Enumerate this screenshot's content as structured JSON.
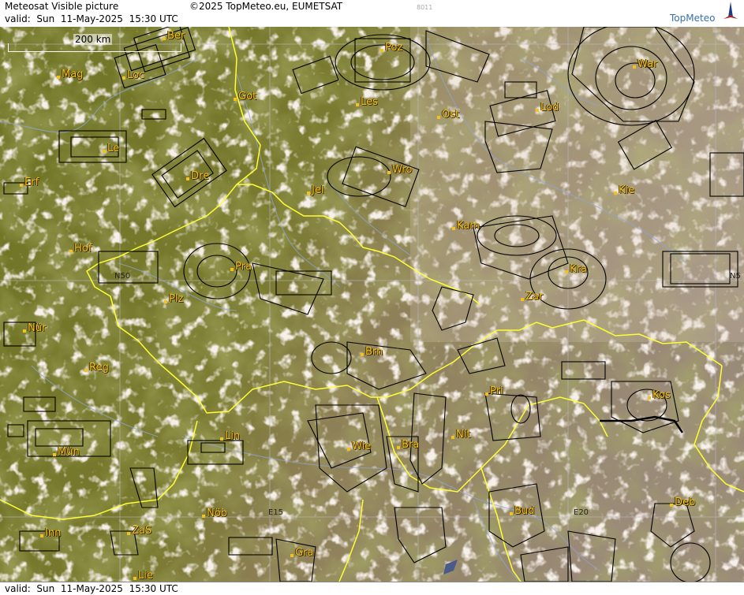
{
  "header": {
    "title": "Meteosat Visible picture",
    "copyright": "©2025 TopMeteo.eu, EUMETSAT",
    "frame_id": "8011",
    "valid": "valid:  Sun  11-May-2025  15:30 UTC",
    "logo": "TopMeteo"
  },
  "footer": {
    "valid": "valid:  Sun  11-May-2025  15:30 UTC"
  },
  "scale_bar": {
    "label": "200 km"
  },
  "grid_labels": [
    "N50",
    "N5",
    "E15",
    "E20"
  ],
  "cities": [
    "Ber",
    "Poz",
    "War",
    "Mag",
    "Loc",
    "Got",
    "Les",
    "Lod",
    "Ost",
    "Le",
    "Dre",
    "Wro",
    "Erf",
    "Jel",
    "Kie",
    "Kam",
    "Hof",
    "Pra",
    "Kra",
    "Plz",
    "Zar",
    "Nür",
    "Brn",
    "Reg",
    "Kos",
    "Pri",
    "Nit",
    "Lin",
    "Mün",
    "Wie",
    "Bra",
    "Nöb",
    "Bud",
    "Deb",
    "Inn",
    "ZaS",
    "Gra",
    "Lie"
  ],
  "colors": {
    "border": "#ffff33",
    "rivers": "#8fa4d8",
    "city_label": "#f4c21a",
    "airspace": "#000000"
  }
}
